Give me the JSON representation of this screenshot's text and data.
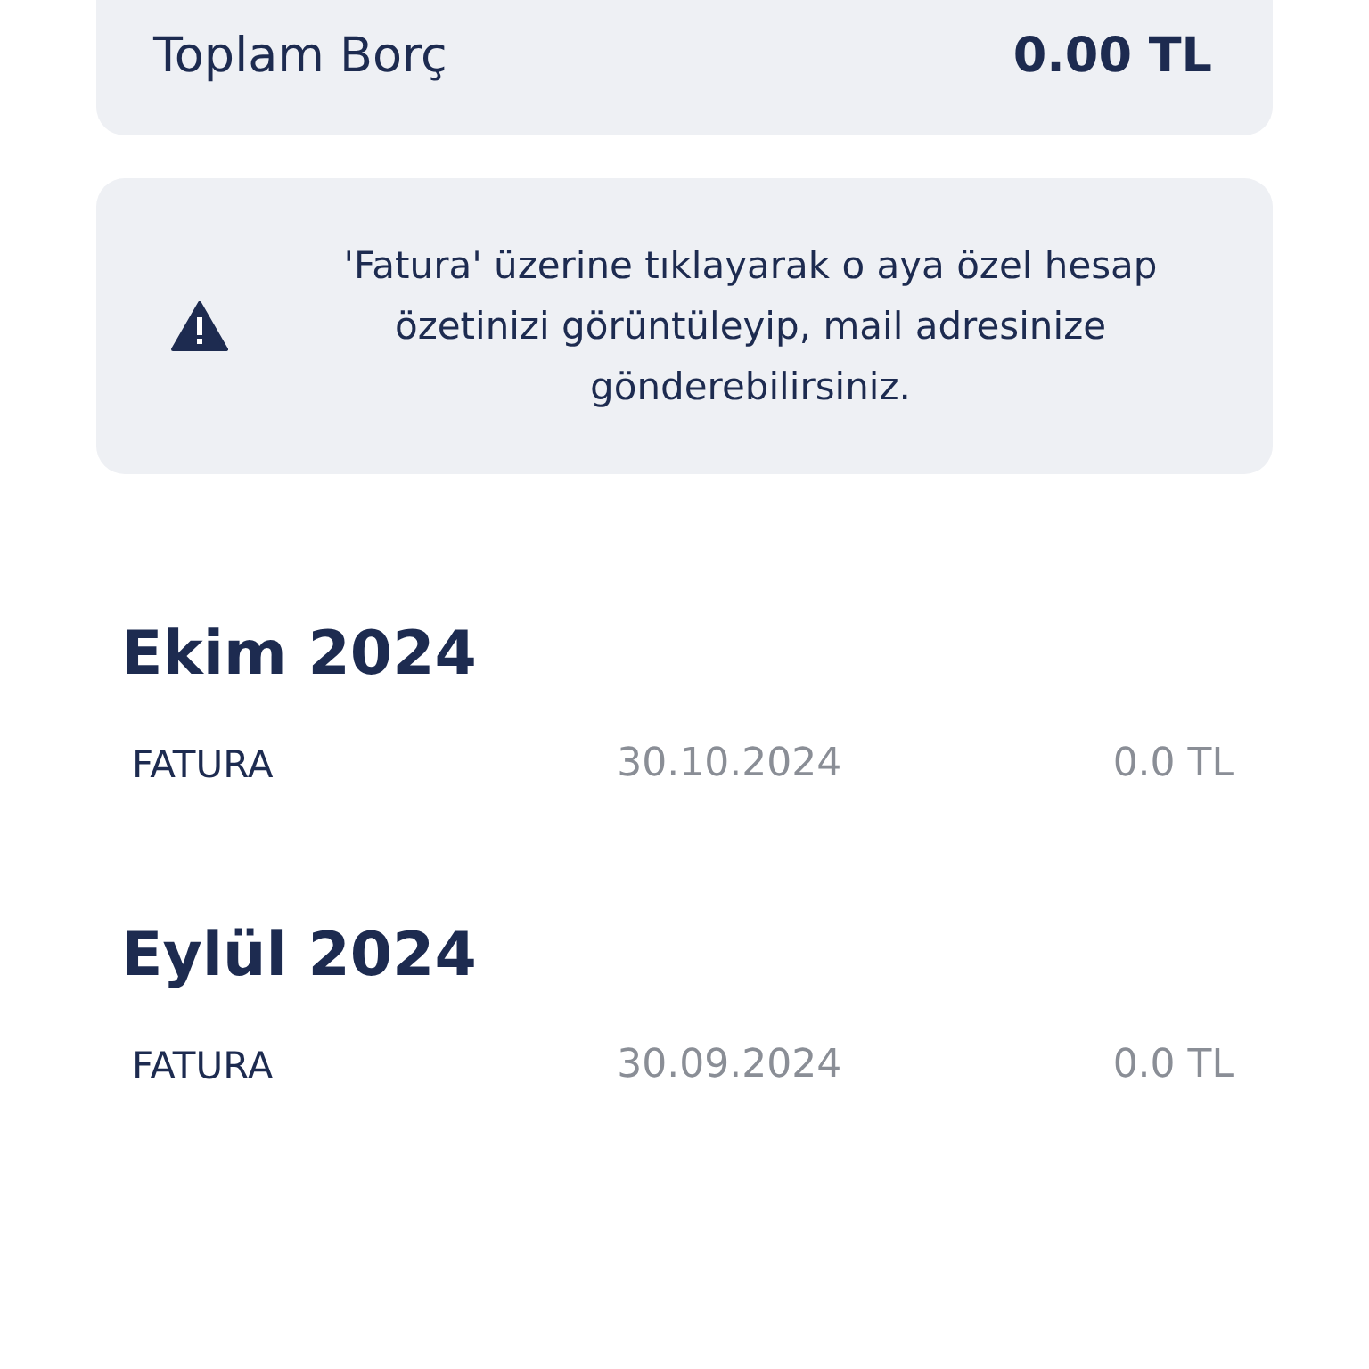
{
  "total": {
    "label": "Toplam Borç",
    "amount": "0.00 TL"
  },
  "notice": {
    "text": "'Fatura' üzerine tıklayarak o aya özel hesap özetinizi görüntüleyip, mail adresinize gönderebilirsiniz."
  },
  "months": [
    {
      "title": "Ekim 2024",
      "rows": [
        {
          "label": "FATURA",
          "date": "30.10.2024",
          "amount": "0.0 TL"
        }
      ]
    },
    {
      "title": "Eylül 2024",
      "rows": [
        {
          "label": "FATURA",
          "date": "30.09.2024",
          "amount": "0.0 TL"
        }
      ]
    }
  ]
}
